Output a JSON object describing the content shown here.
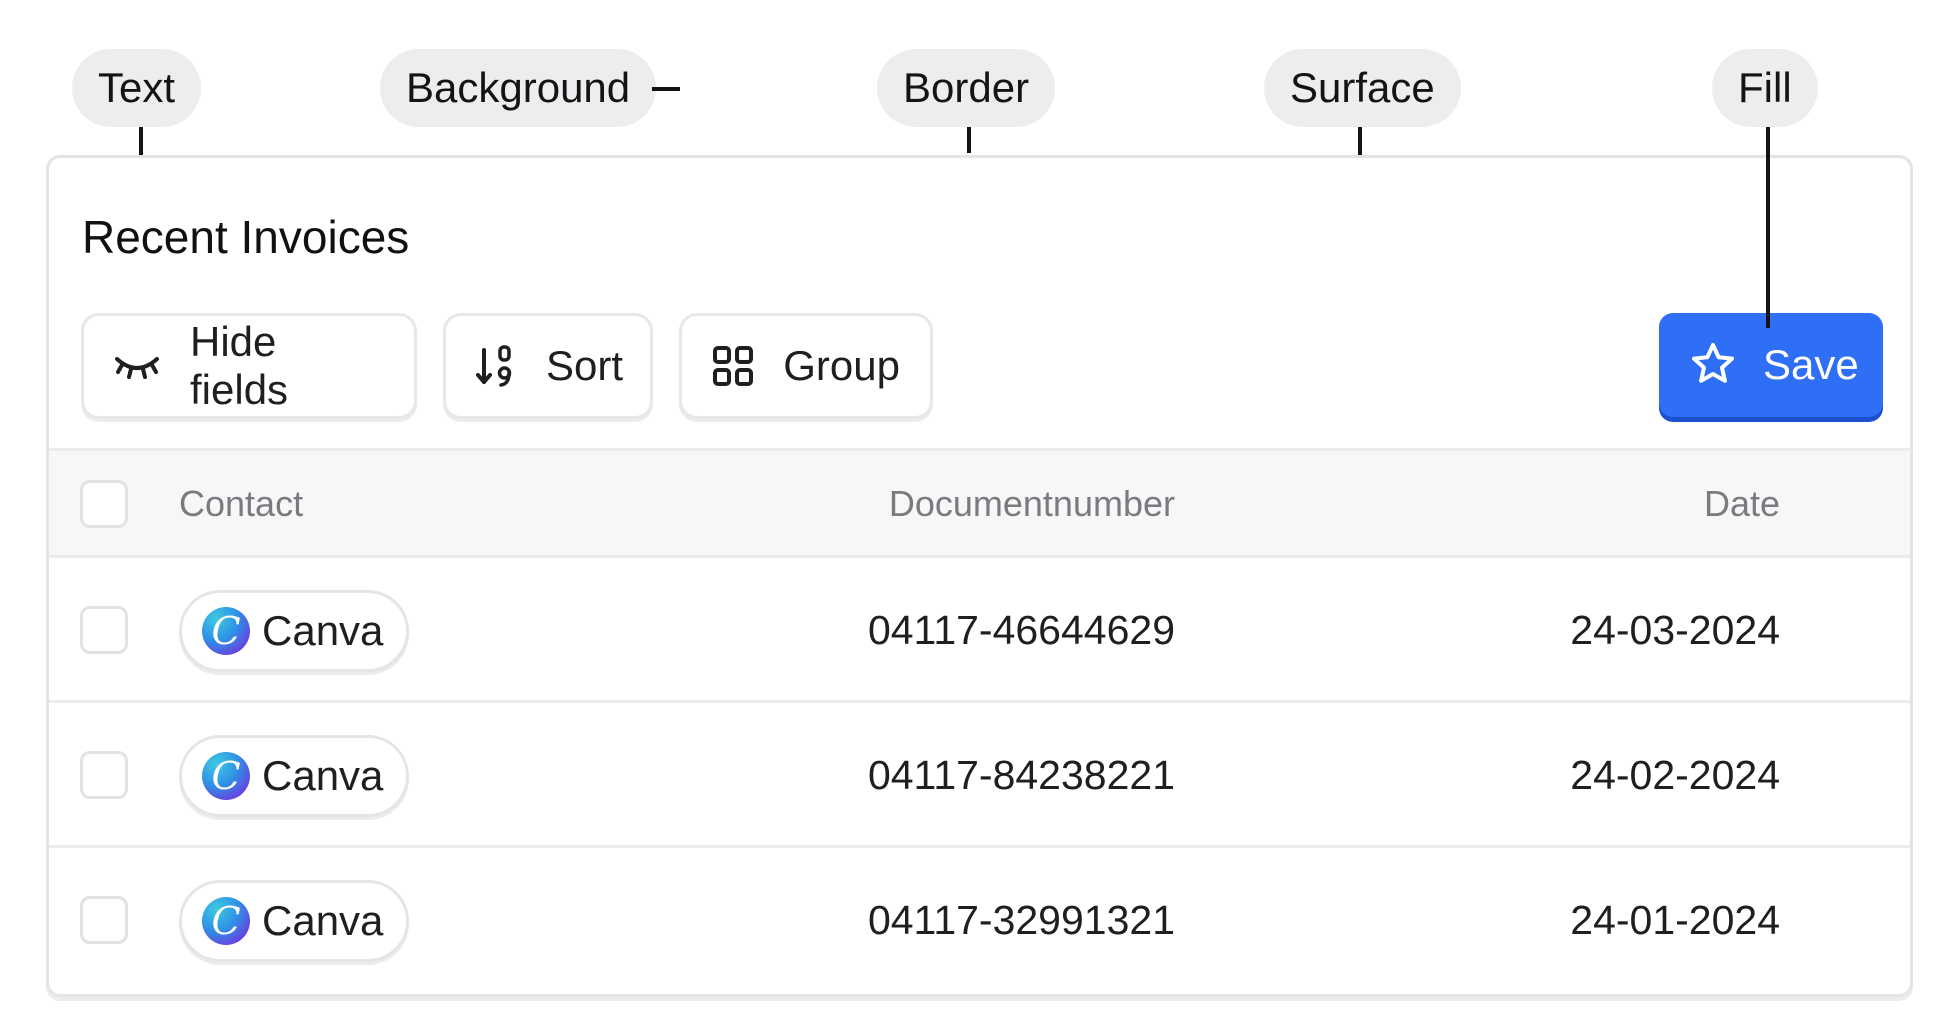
{
  "annotations": {
    "text": "Text",
    "background": "Background",
    "border": "Border",
    "surface": "Surface",
    "fill": "Fill"
  },
  "card": {
    "title": "Recent Invoices"
  },
  "toolbar": {
    "hide_fields_label": "Hide fields",
    "sort_label": "Sort",
    "group_label": "Group",
    "save_label": "Save"
  },
  "table": {
    "columns": [
      "Contact",
      "Documentnumber",
      "Date"
    ],
    "rows": [
      {
        "contact": "Canva",
        "logo_letter": "C",
        "document_number": "04117-46644629",
        "date": "24-03-2024"
      },
      {
        "contact": "Canva",
        "logo_letter": "C",
        "document_number": "04117-84238221",
        "date": "24-02-2024"
      },
      {
        "contact": "Canva",
        "logo_letter": "C",
        "document_number": "04117-32991321",
        "date": "24-01-2024"
      }
    ]
  },
  "icons": {
    "hide_fields": "eye-closed-icon",
    "sort": "sort-numeric-icon",
    "group": "grid-icon",
    "save": "star-icon"
  },
  "colors": {
    "fill_accent": "#2f6ff5",
    "border": "#e4e4e7",
    "header_surface": "#f7f7f8"
  }
}
